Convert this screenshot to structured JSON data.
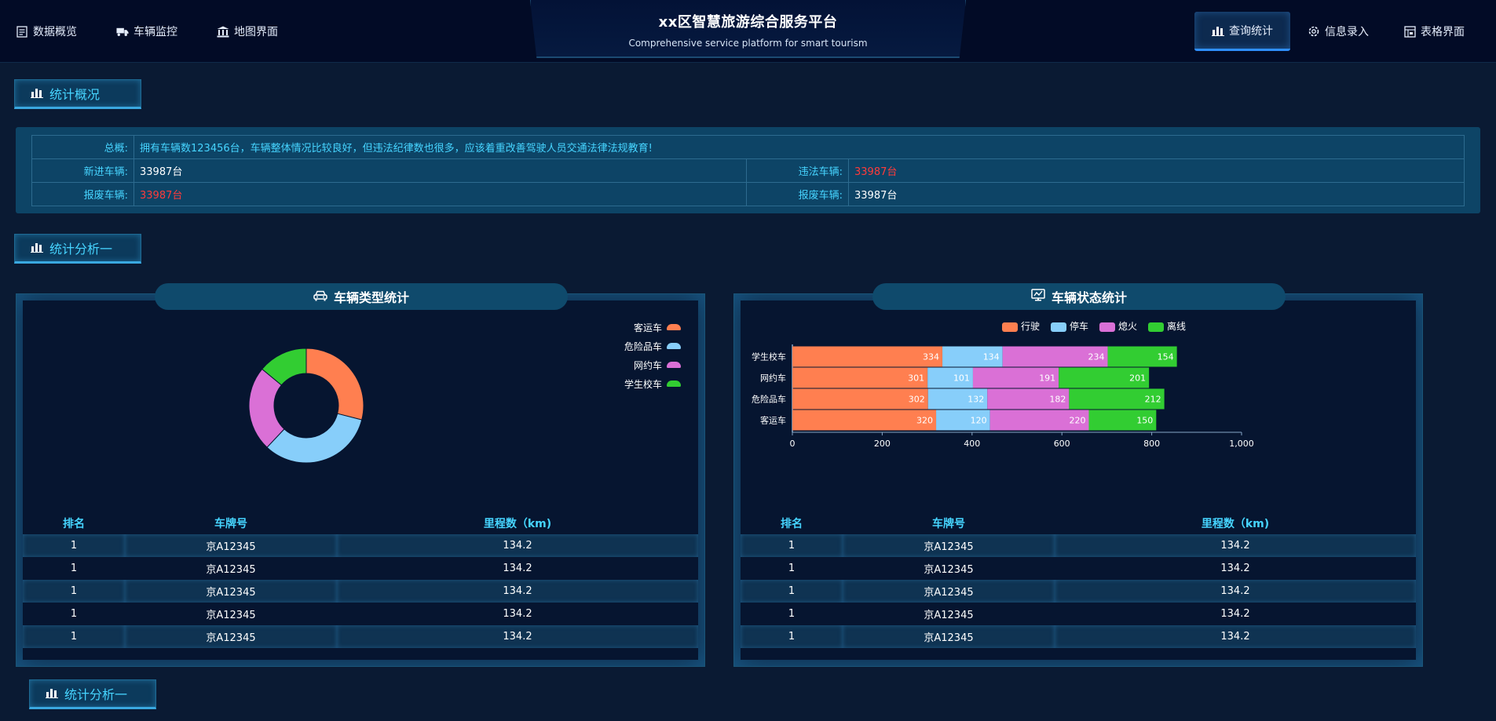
{
  "header": {
    "title": "xx区智慧旅游综合服务平台",
    "subtitle": "Comprehensive service platform for smart tourism",
    "nav_left": [
      {
        "label": "数据概览",
        "icon": "document-icon"
      },
      {
        "label": "车辆监控",
        "icon": "truck-icon"
      },
      {
        "label": "地图界面",
        "icon": "building-icon"
      }
    ],
    "nav_right": [
      {
        "label": "查询统计",
        "icon": "bar-chart-icon",
        "active": true
      },
      {
        "label": "信息录入",
        "icon": "gear-icon"
      },
      {
        "label": "表格界面",
        "icon": "table-icon"
      }
    ]
  },
  "sections": {
    "overview_title": "统计概况",
    "analysis_title": "统计分析一",
    "analysis2_title": "统计分析一"
  },
  "overview": {
    "summary_label": "总概:",
    "summary_text": "拥有车辆数123456台，车辆整体情况比较良好，但违法纪律数也很多，应该着重改善驾驶人员交通法律法规教育!",
    "new_label": "新进车辆:",
    "new_value": "33987台",
    "violation_label": "违法车辆:",
    "violation_value": "33987台",
    "scrap_label": "报废车辆:",
    "scrap_value": "33987台",
    "scrap2_label": "报废车辆:",
    "scrap2_value": "33987台"
  },
  "panel_left": {
    "title": "车辆类型统计",
    "icon": "car-icon"
  },
  "panel_right": {
    "title": "车辆状态统计",
    "icon": "monitor-chart-icon"
  },
  "table": {
    "headers": [
      "排名",
      "车牌号",
      "里程数（km)"
    ],
    "rows": [
      [
        "1",
        "京A12345",
        "134.2"
      ],
      [
        "1",
        "京A12345",
        "134.2"
      ],
      [
        "1",
        "京A12345",
        "134.2"
      ],
      [
        "1",
        "京A12345",
        "134.2"
      ],
      [
        "1",
        "京A12345",
        "134.2"
      ]
    ]
  },
  "chart_data": [
    {
      "type": "pie",
      "title": "",
      "categories": [
        "客运车",
        "危险品车",
        "网约车",
        "学生校车"
      ],
      "values": [
        29,
        33,
        24,
        14
      ],
      "colors": [
        "#ff7f50",
        "#87cefa",
        "#da70d6",
        "#32cd32"
      ],
      "legend": "top-right"
    },
    {
      "type": "bar",
      "orientation": "horizontal",
      "stacked": true,
      "categories": [
        "客运车",
        "危险品车",
        "网约车",
        "学生校车"
      ],
      "series": [
        {
          "name": "行驶",
          "values": [
            320,
            302,
            301,
            334
          ],
          "color": "#ff7f50"
        },
        {
          "name": "停车",
          "values": [
            120,
            132,
            101,
            134
          ],
          "color": "#87cefa"
        },
        {
          "name": "熄火",
          "values": [
            220,
            182,
            191,
            234
          ],
          "color": "#da70d6"
        },
        {
          "name": "离线",
          "values": [
            150,
            212,
            201,
            154
          ],
          "color": "#32cd32"
        }
      ],
      "xlim": [
        0,
        1000
      ],
      "xticks": [
        "0",
        "200",
        "400",
        "600",
        "800",
        "1,000"
      ],
      "legend": "top"
    }
  ]
}
